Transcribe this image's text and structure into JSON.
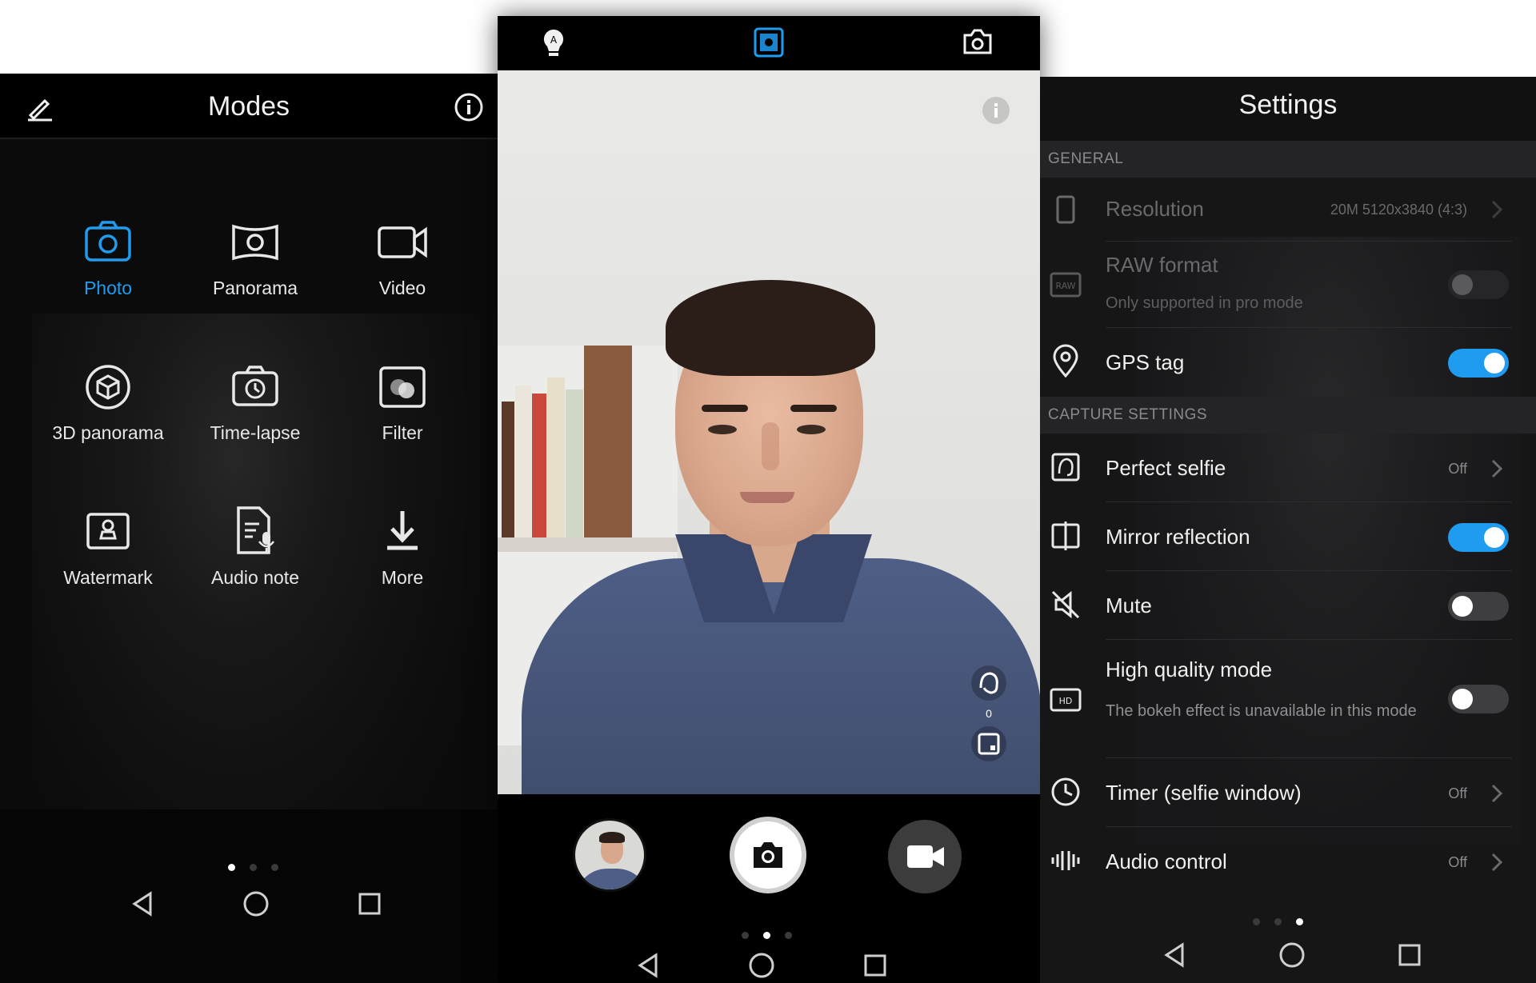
{
  "modes_panel": {
    "title": "Modes",
    "modes": [
      {
        "label": "Photo",
        "icon": "camera-icon",
        "active": true
      },
      {
        "label": "Panorama",
        "icon": "panorama-icon"
      },
      {
        "label": "Video",
        "icon": "video-icon"
      },
      {
        "label": "3D panorama",
        "icon": "3d-panorama-icon"
      },
      {
        "label": "Time-lapse",
        "icon": "time-lapse-icon"
      },
      {
        "label": "Filter",
        "icon": "filter-icon"
      },
      {
        "label": "Watermark",
        "icon": "watermark-icon"
      },
      {
        "label": "Audio note",
        "icon": "audio-note-icon"
      },
      {
        "label": "More",
        "icon": "download-icon"
      }
    ],
    "page_indicator": {
      "current": 1,
      "total": 3
    }
  },
  "camera_panel": {
    "top_icons": [
      "flash-auto-icon",
      "portrait-mode-icon",
      "switch-camera-icon"
    ],
    "beauty_level": "0",
    "page_indicator": {
      "current": 2,
      "total": 3
    }
  },
  "settings_panel": {
    "title": "Settings",
    "sections": {
      "general": "GENERAL",
      "capture": "CAPTURE SETTINGS"
    },
    "items": {
      "resolution": {
        "label": "Resolution",
        "value": "20M 5120x3840 (4:3)"
      },
      "raw": {
        "label": "RAW format",
        "sub": "Only supported in pro mode",
        "state": "disabled"
      },
      "gps": {
        "label": "GPS tag",
        "state": "on"
      },
      "perfect_selfie": {
        "label": "Perfect selfie",
        "value": "Off"
      },
      "mirror": {
        "label": "Mirror reflection",
        "state": "on"
      },
      "mute": {
        "label": "Mute",
        "state": "off"
      },
      "hq": {
        "label": "High quality mode",
        "sub": "The bokeh effect is unavailable in this mode",
        "state": "off"
      },
      "timer": {
        "label": "Timer (selfie window)",
        "value": "Off"
      },
      "audio": {
        "label": "Audio control",
        "value": "Off"
      }
    },
    "page_indicator": {
      "current": 3,
      "total": 3
    }
  },
  "colors": {
    "accent": "#1f9cf0",
    "background": "#0b0b0b",
    "text": "#f0f0f0"
  }
}
